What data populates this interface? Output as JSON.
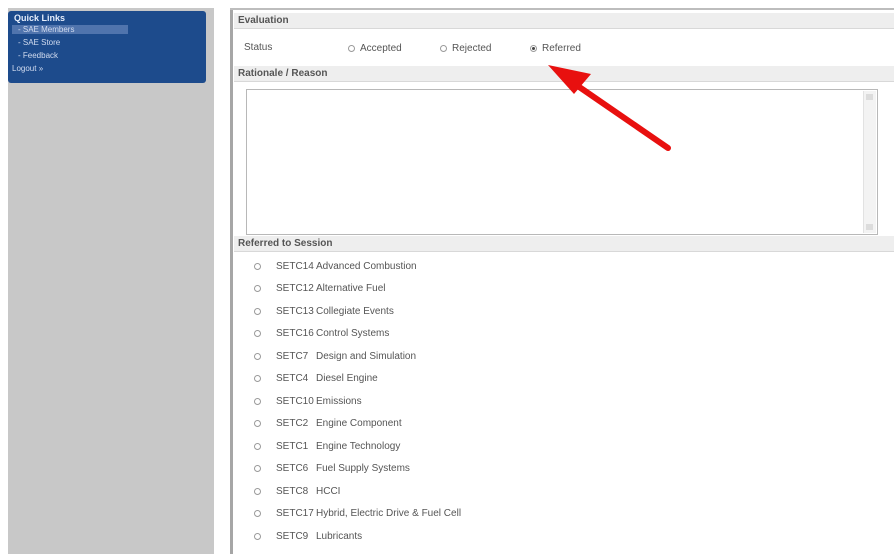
{
  "sidebar": {
    "title": "Quick Links",
    "items": [
      {
        "label": "- SAE Members",
        "highlighted": true
      },
      {
        "label": "- SAE Store",
        "highlighted": false
      },
      {
        "label": "- Feedback",
        "highlighted": false
      },
      {
        "label": "Logout »",
        "highlighted": false
      }
    ]
  },
  "evaluation": {
    "header": "Evaluation",
    "status_label": "Status",
    "options": [
      {
        "label": "Accepted",
        "selected": false
      },
      {
        "label": "Rejected",
        "selected": false
      },
      {
        "label": "Referred",
        "selected": true
      }
    ]
  },
  "rationale": {
    "header": "Rationale / Reason",
    "value": ""
  },
  "referred": {
    "header": "Referred to Session",
    "sessions": [
      {
        "code": "SETC14",
        "name": "Advanced Combustion",
        "selected": false
      },
      {
        "code": "SETC12",
        "name": "Alternative Fuel",
        "selected": false
      },
      {
        "code": "SETC13",
        "name": "Collegiate Events",
        "selected": false
      },
      {
        "code": "SETC16",
        "name": "Control Systems",
        "selected": false
      },
      {
        "code": "SETC7",
        "name": "Design and Simulation",
        "selected": false
      },
      {
        "code": "SETC4",
        "name": "Diesel Engine",
        "selected": false
      },
      {
        "code": "SETC10",
        "name": "Emissions",
        "selected": false
      },
      {
        "code": "SETC2",
        "name": "Engine Component",
        "selected": false
      },
      {
        "code": "SETC1",
        "name": "Engine Technology",
        "selected": false
      },
      {
        "code": "SETC6",
        "name": "Fuel Supply Systems",
        "selected": false
      },
      {
        "code": "SETC8",
        "name": "HCCI",
        "selected": false
      },
      {
        "code": "SETC17",
        "name": "Hybrid, Electric Drive & Fuel Cell",
        "selected": false
      },
      {
        "code": "SETC9",
        "name": "Lubricants",
        "selected": false
      }
    ]
  },
  "annotation": {
    "arrow_color": "#e8100f"
  },
  "colors": {
    "sidebar_blue": "#1d4b8c",
    "sidebar_bg": "#c8c8c8"
  }
}
